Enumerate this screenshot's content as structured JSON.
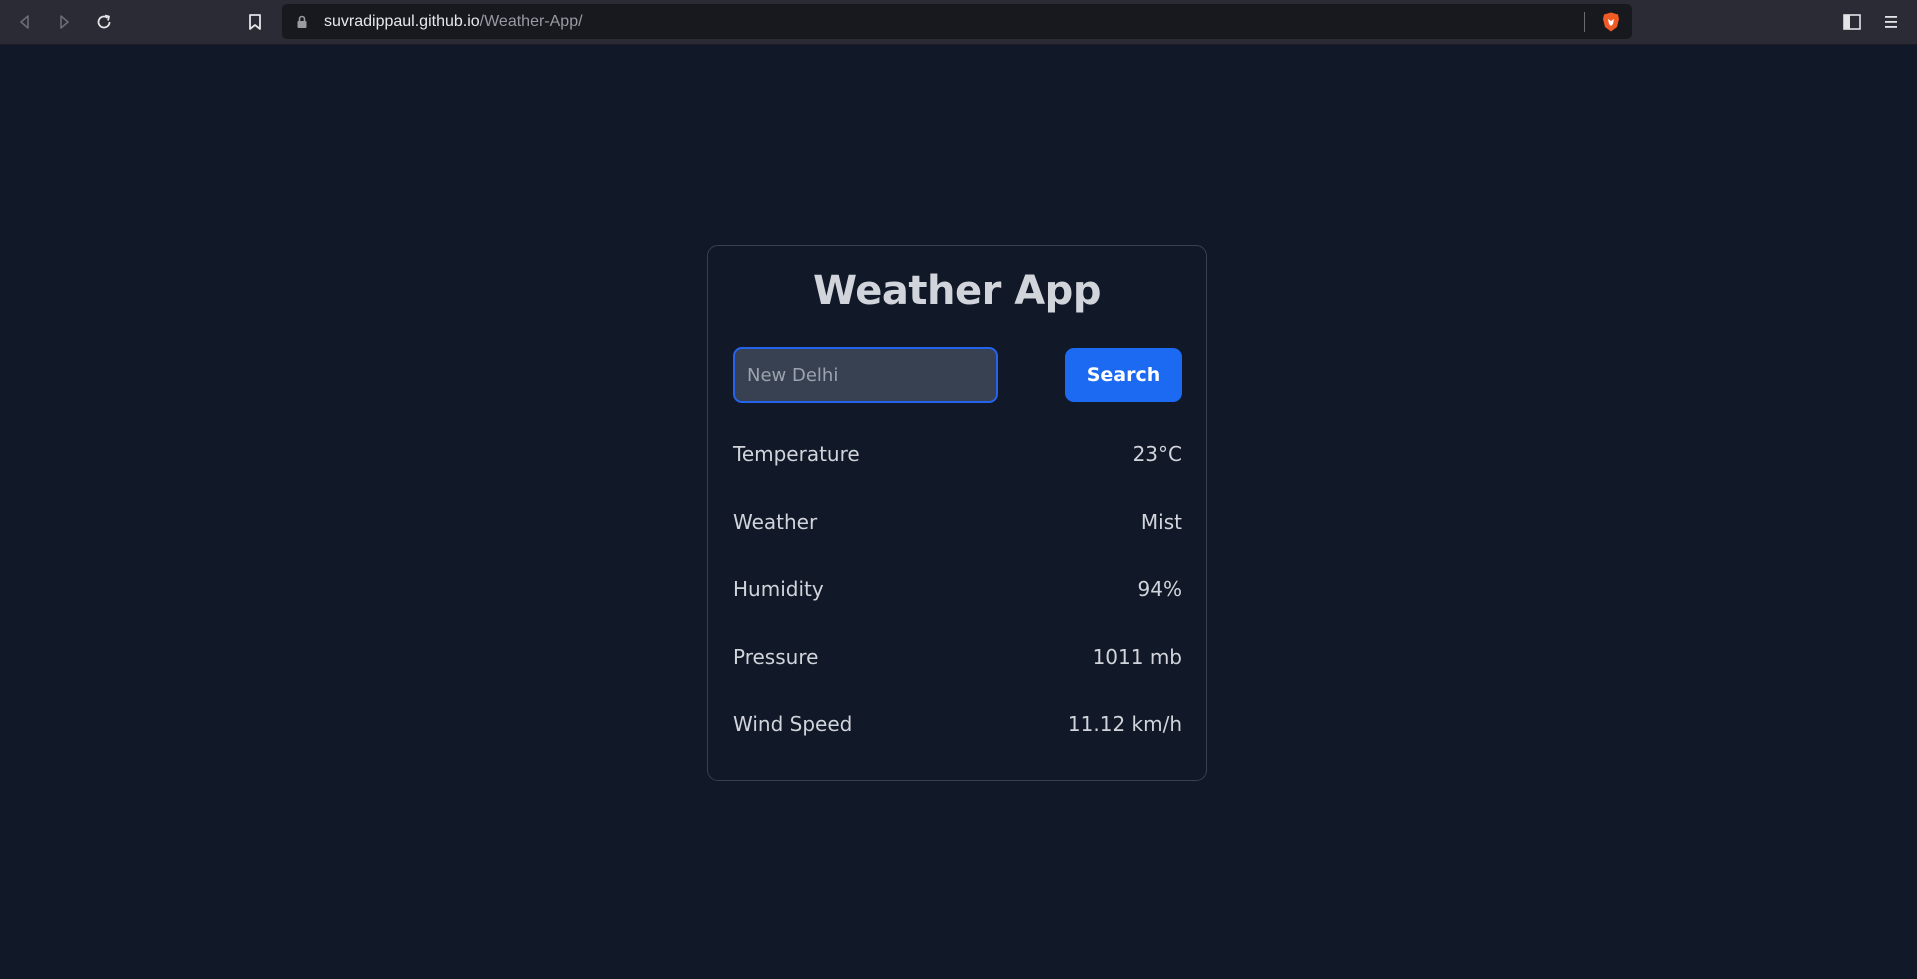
{
  "browser": {
    "url_host": "suvradippaul.github.io",
    "url_path": "/Weather-App/",
    "icons": [
      "back-icon",
      "forward-icon",
      "reload-icon",
      "bookmark-icon",
      "lock-icon",
      "brave-shield-icon",
      "sidebar-icon",
      "menu-icon"
    ]
  },
  "app": {
    "title": "Weather App",
    "search": {
      "value": "New Delhi",
      "placeholder": "",
      "button_label": "Search"
    },
    "rows": [
      {
        "label": "Temperature",
        "value": "23°C"
      },
      {
        "label": "Weather",
        "value": "Mist"
      },
      {
        "label": "Humidity",
        "value": "94%"
      },
      {
        "label": "Pressure",
        "value": "1011 mb"
      },
      {
        "label": "Wind Speed",
        "value": "11.12 km/h"
      }
    ]
  },
  "colors": {
    "background": "#111827",
    "card_border": "#374151",
    "accent": "#1d6af2",
    "text": "#d1d5db",
    "toolbar": "#2a2b35"
  }
}
